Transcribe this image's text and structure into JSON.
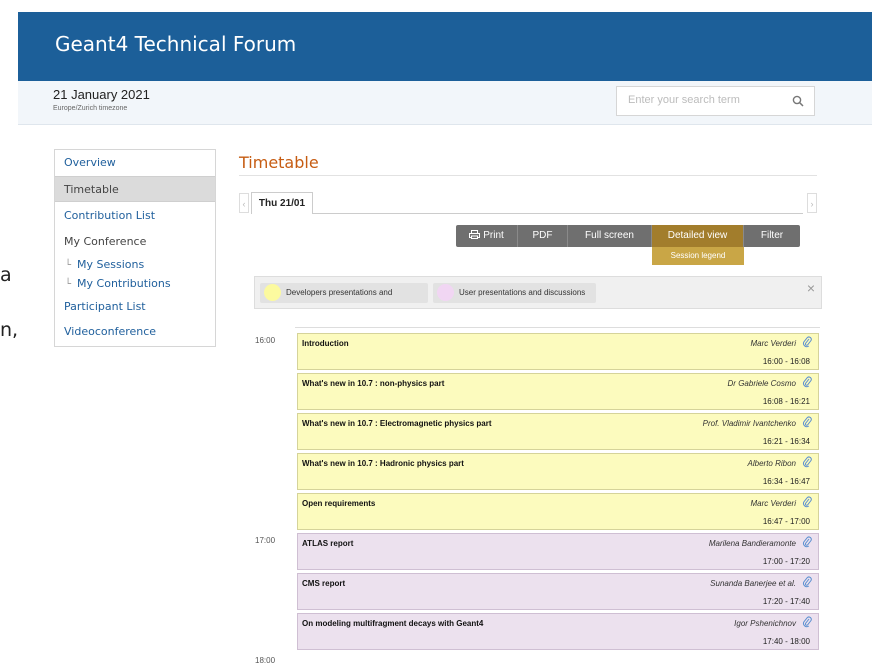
{
  "header": {
    "title": "Geant4 Technical Forum"
  },
  "subheader": {
    "date": "21 January 2021",
    "timezone": "Europe/Zurich timezone",
    "search_placeholder": "Enter your search term"
  },
  "left_fragments": [
    "a",
    "n,"
  ],
  "menu": {
    "overview": "Overview",
    "timetable": "Timetable",
    "contribution_list": "Contribution List",
    "my_conference": "My Conference",
    "my_sessions": "My Sessions",
    "my_contributions": "My Contributions",
    "participant_list": "Participant List",
    "videoconference": "Videoconference"
  },
  "timetable": {
    "heading": "Timetable",
    "day_tab": "Thu 21/01",
    "toolbar": {
      "print": "Print",
      "pdf": "PDF",
      "full_screen": "Full screen",
      "detailed_view": "Detailed view",
      "filter": "Filter",
      "session_legend": "Session legend"
    },
    "legend": [
      {
        "label": "Developers presentations and",
        "color": "#fcfa9f"
      },
      {
        "label": "User presentations and discussions",
        "color": "#f1d6f3"
      }
    ],
    "hours": [
      "16:00",
      "17:00",
      "18:00"
    ],
    "entries": [
      {
        "title": "Introduction",
        "speaker": "Marc Verderi",
        "time": "16:00 - 16:08",
        "session": "dev"
      },
      {
        "title": "What's new in 10.7 : non-physics part",
        "speaker": "Dr Gabriele Cosmo",
        "time": "16:08 - 16:21",
        "session": "dev"
      },
      {
        "title": "What's new in 10.7 : Electromagnetic physics part",
        "speaker": "Prof. Vladimir Ivantchenko",
        "time": "16:21 - 16:34",
        "session": "dev"
      },
      {
        "title": "What's new in 10.7 : Hadronic physics part",
        "speaker": "Alberto Ribon",
        "time": "16:34 - 16:47",
        "session": "dev"
      },
      {
        "title": "Open requirements",
        "speaker": "Marc Verderi",
        "time": "16:47 - 17:00",
        "session": "dev"
      },
      {
        "title": "ATLAS report",
        "speaker": "Marilena Bandieramonte",
        "time": "17:00 - 17:20",
        "session": "user"
      },
      {
        "title": "CMS report",
        "speaker": "Sunanda Banerjee et al.",
        "time": "17:20 - 17:40",
        "session": "user"
      },
      {
        "title": "On modeling multifragment decays with Geant4",
        "speaker": "Igor Pshenichnov",
        "time": "17:40 - 18:00",
        "session": "user"
      }
    ]
  }
}
